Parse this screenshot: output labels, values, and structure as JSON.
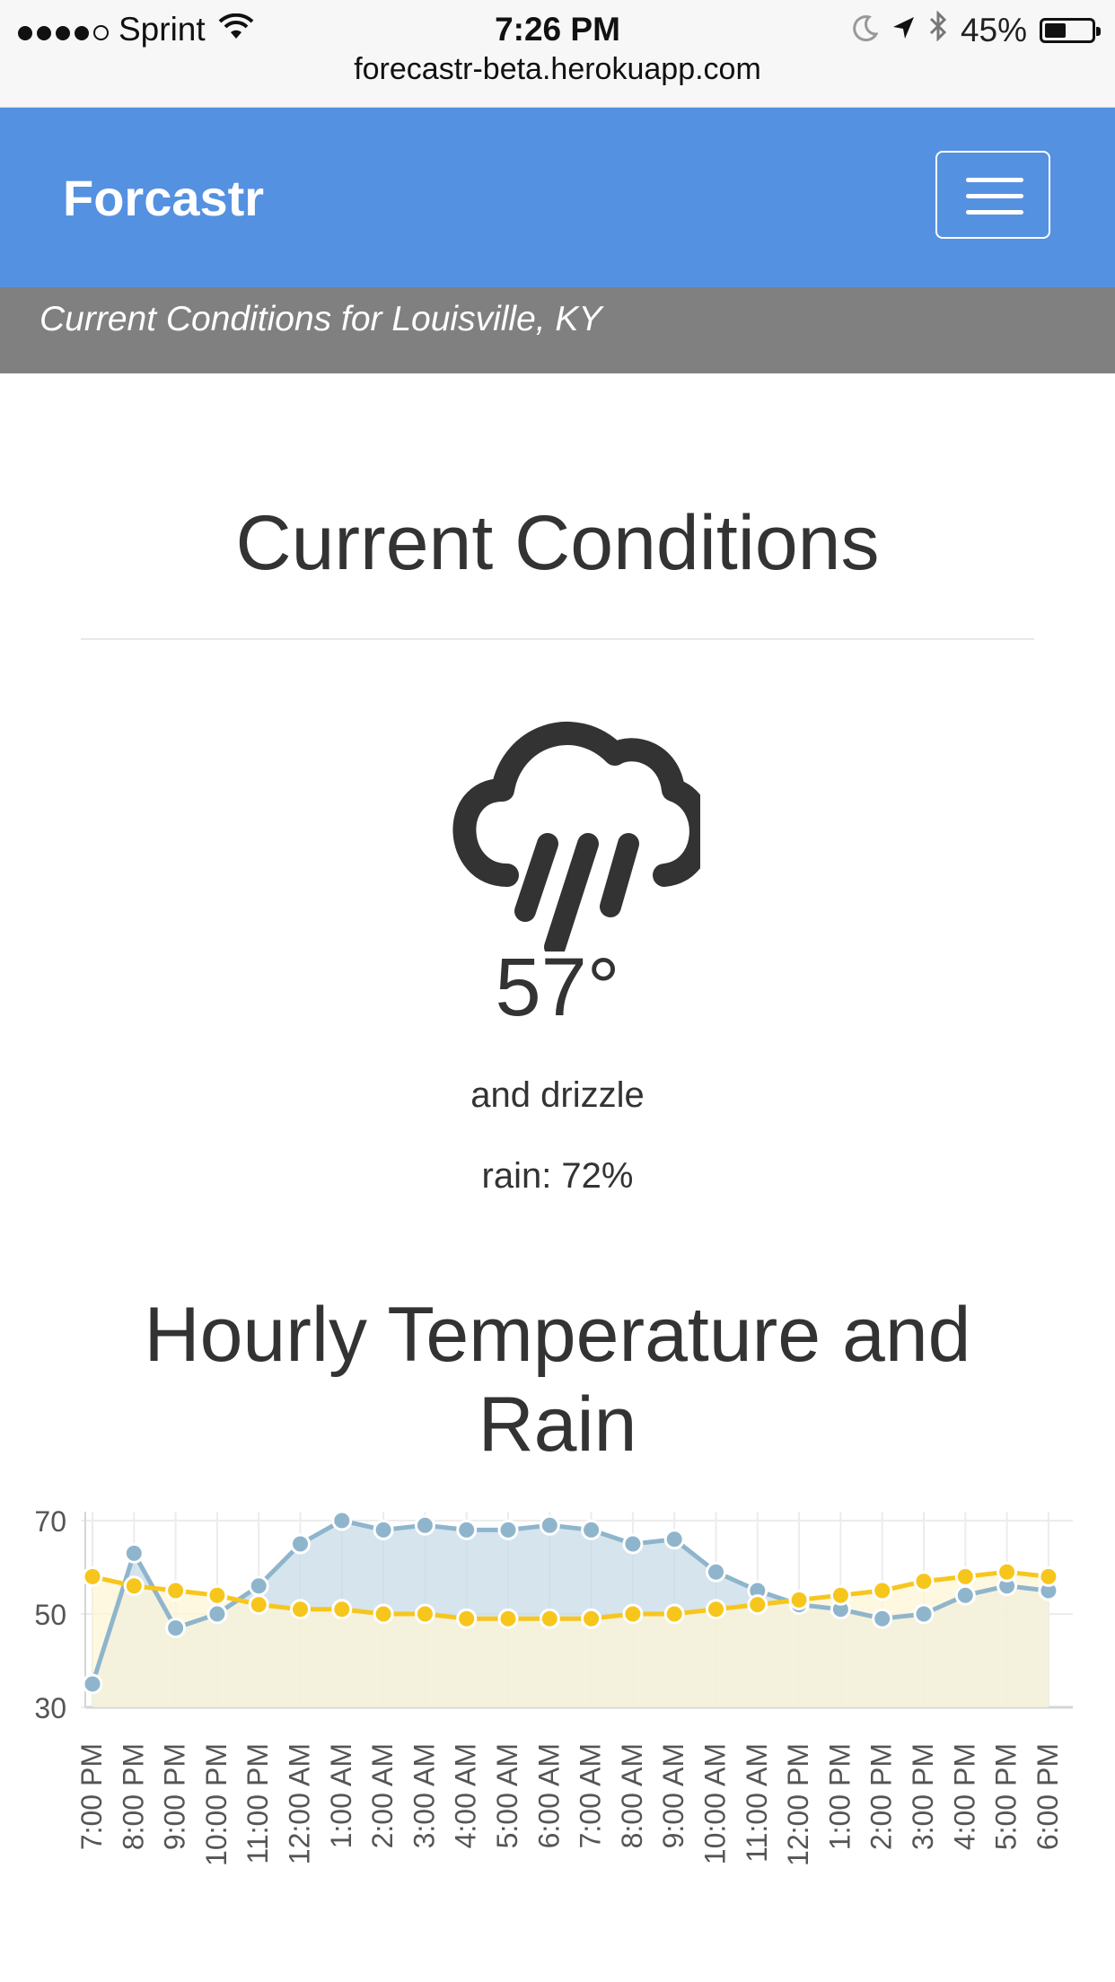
{
  "status_bar": {
    "carrier": "Sprint",
    "time": "7:26 PM",
    "battery": "45%",
    "battery_level": 0.45,
    "url": "forecastr-beta.herokuapp.com"
  },
  "navbar": {
    "brand": "Forcastr",
    "location_text": "Current Conditions for Louisville, KY"
  },
  "current": {
    "heading": "Current Conditions",
    "icon": "rain-cloud-icon",
    "temperature": "57°",
    "description": "and drizzle",
    "rain": "rain: 72%"
  },
  "hourly": {
    "heading_line1": "Hourly Temperature and",
    "heading_line2": "Rain"
  },
  "chart_data": {
    "type": "area",
    "categories": [
      "7:00 PM",
      "8:00 PM",
      "9:00 PM",
      "10:00 PM",
      "11:00 PM",
      "12:00 AM",
      "1:00 AM",
      "2:00 AM",
      "3:00 AM",
      "4:00 AM",
      "5:00 AM",
      "6:00 AM",
      "7:00 AM",
      "8:00 AM",
      "9:00 AM",
      "10:00 AM",
      "11:00 AM",
      "12:00 PM",
      "1:00 PM",
      "2:00 PM",
      "3:00 PM",
      "4:00 PM",
      "5:00 PM",
      "6:00 PM"
    ],
    "ytick_labels": [
      "70",
      "50",
      "30"
    ],
    "ylim": [
      30,
      70
    ],
    "grid": true,
    "series": [
      {
        "values": [
          35,
          63,
          47,
          50,
          56,
          65,
          70,
          68,
          69,
          68,
          68,
          69,
          68,
          65,
          66,
          59,
          55,
          52,
          51,
          49,
          50,
          54,
          56,
          55
        ],
        "color": "#8fb5cc",
        "fill": "#c8dbe8"
      },
      {
        "values": [
          58,
          56,
          55,
          54,
          52,
          51,
          51,
          50,
          50,
          49,
          49,
          49,
          49,
          50,
          50,
          51,
          52,
          53,
          54,
          55,
          57,
          58,
          59,
          58
        ],
        "color": "#f7c61d",
        "fill": "#fdf6d5"
      }
    ]
  },
  "colors": {
    "navbar": "#5591e1",
    "subbar": "#808080",
    "text": "#333333"
  }
}
